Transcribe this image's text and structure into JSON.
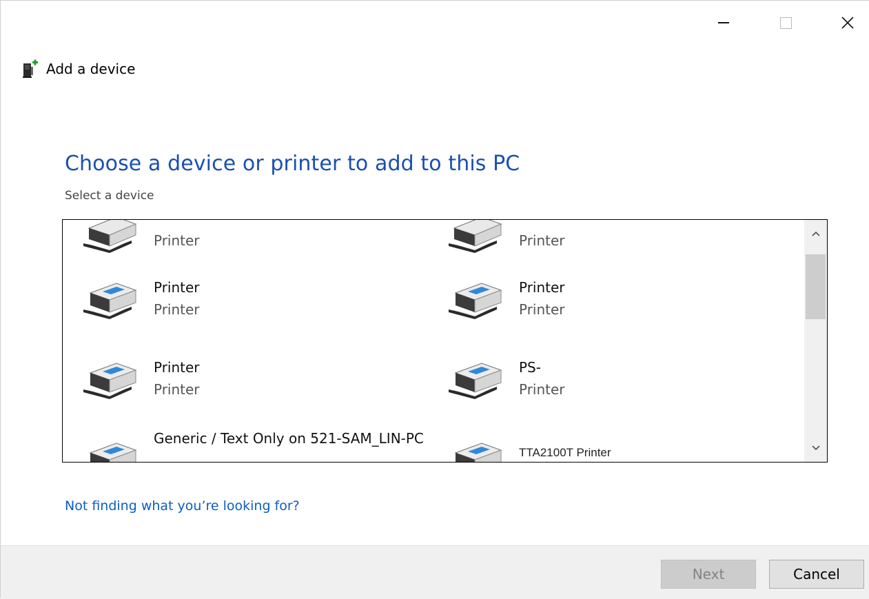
{
  "window": {
    "title": "Add a device",
    "controls": {
      "minimize": "minimize-icon",
      "maximize": "maximize-icon",
      "close": "close-icon"
    }
  },
  "page": {
    "heading": "Choose a device or printer to add to this PC",
    "subheading": "Select a device"
  },
  "devices": [
    {
      "name": "",
      "type": "Printer",
      "icon": "printer-icon"
    },
    {
      "name": "",
      "type": "Printer",
      "icon": "printer-icon"
    },
    {
      "name": "Printer",
      "type": "Printer",
      "icon": "printer-icon"
    },
    {
      "name": "Printer",
      "type": "Printer",
      "icon": "printer-icon"
    },
    {
      "name": "Printer",
      "type": "Printer",
      "icon": "printer-icon"
    },
    {
      "name": "PS-",
      "type": "Printer",
      "icon": "printer-icon"
    },
    {
      "name": "Generic / Text Only on 521-SAM_LIN-PC",
      "type": "",
      "icon": "printer-icon"
    },
    {
      "name": "TTA2100T Printer",
      "type": "",
      "icon": "printer-icon"
    }
  ],
  "help_link": "Not finding what you’re looking for?",
  "footer": {
    "next_label": "Next",
    "cancel_label": "Cancel"
  },
  "colors": {
    "heading": "#1a4fb0",
    "link": "#0a5ec4",
    "footer_bg": "#f0f0f0",
    "add_icon_green": "#1f9d2a"
  }
}
